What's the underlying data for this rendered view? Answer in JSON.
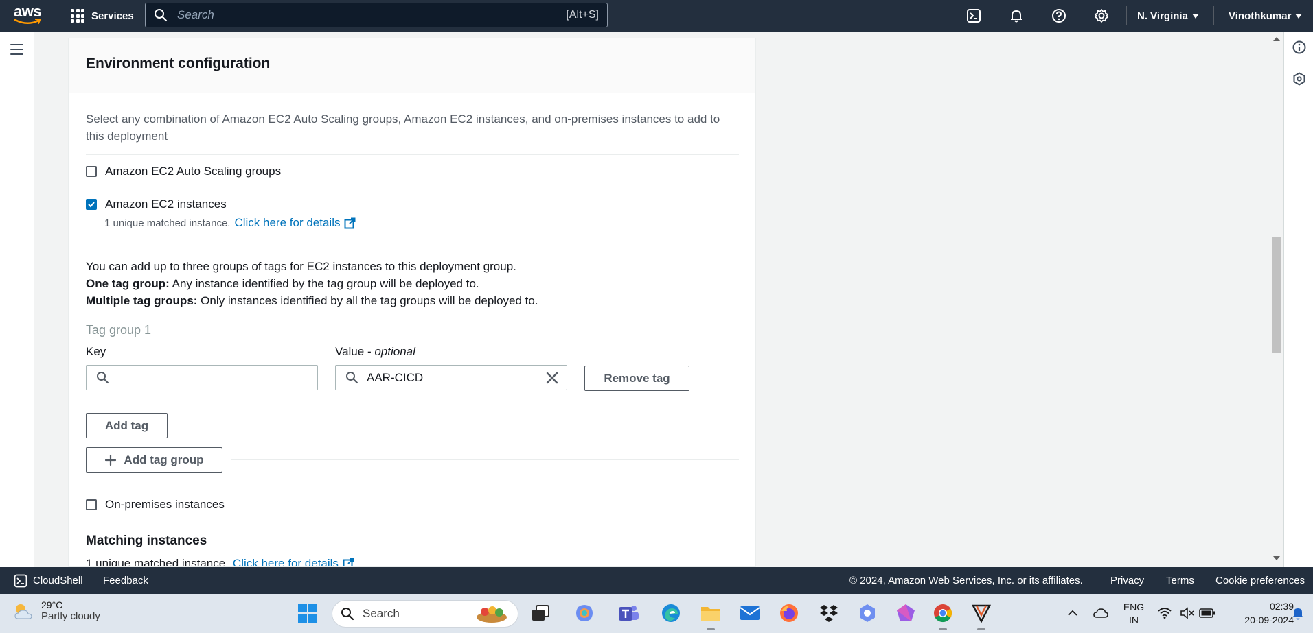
{
  "topnav": {
    "logo": "aws",
    "services_label": "Services",
    "search_placeholder": "Search",
    "search_shortcut": "[Alt+S]",
    "region": "N. Virginia",
    "user": "Vinothkumar"
  },
  "card": {
    "title": "Environment configuration",
    "description": "Select any combination of Amazon EC2 Auto Scaling groups, Amazon EC2 instances, and on-premises instances to add to this deployment",
    "options": {
      "asg": {
        "label": "Amazon EC2 Auto Scaling groups",
        "checked": false
      },
      "ec2": {
        "label": "Amazon EC2 instances",
        "checked": true
      },
      "onprem": {
        "label": "On-premises instances",
        "checked": false
      }
    },
    "ec2_match_text": "1 unique matched instance.",
    "ec2_match_link": "Click here for details",
    "tags_info_line1": "You can add up to three groups of tags for EC2 instances to this deployment group.",
    "tags_info_one_bold": "One tag group:",
    "tags_info_one_text": " Any instance identified by the tag group will be deployed to.",
    "tags_info_multi_bold": "Multiple tag groups:",
    "tags_info_multi_text": " Only instances identified by all the tag groups will be deployed to.",
    "tag_group_label": "Tag group 1",
    "key_label": "Key",
    "key_value": "",
    "value_label": "Value - ",
    "value_optional": "optional",
    "value_value": "AAR-CICD",
    "remove_tag_label": "Remove tag",
    "add_tag_label": "Add tag",
    "add_tag_group_label": "Add tag group",
    "matching_title": "Matching instances",
    "matching_text": "1 unique matched instance.",
    "matching_link": "Click here for details"
  },
  "footer": {
    "cloudshell": "CloudShell",
    "feedback": "Feedback",
    "copyright": "© 2024, Amazon Web Services, Inc. or its affiliates.",
    "privacy": "Privacy",
    "terms": "Terms",
    "cookies": "Cookie preferences"
  },
  "taskbar": {
    "temp": "29°C",
    "weather": "Partly cloudy",
    "search_placeholder": "Search",
    "lang1": "ENG",
    "lang2": "IN",
    "time": "02:39",
    "date": "20-09-2024"
  },
  "colors": {
    "nav_bg": "#232f3e",
    "link": "#0073bb",
    "checkbox_on": "#0073bb"
  }
}
